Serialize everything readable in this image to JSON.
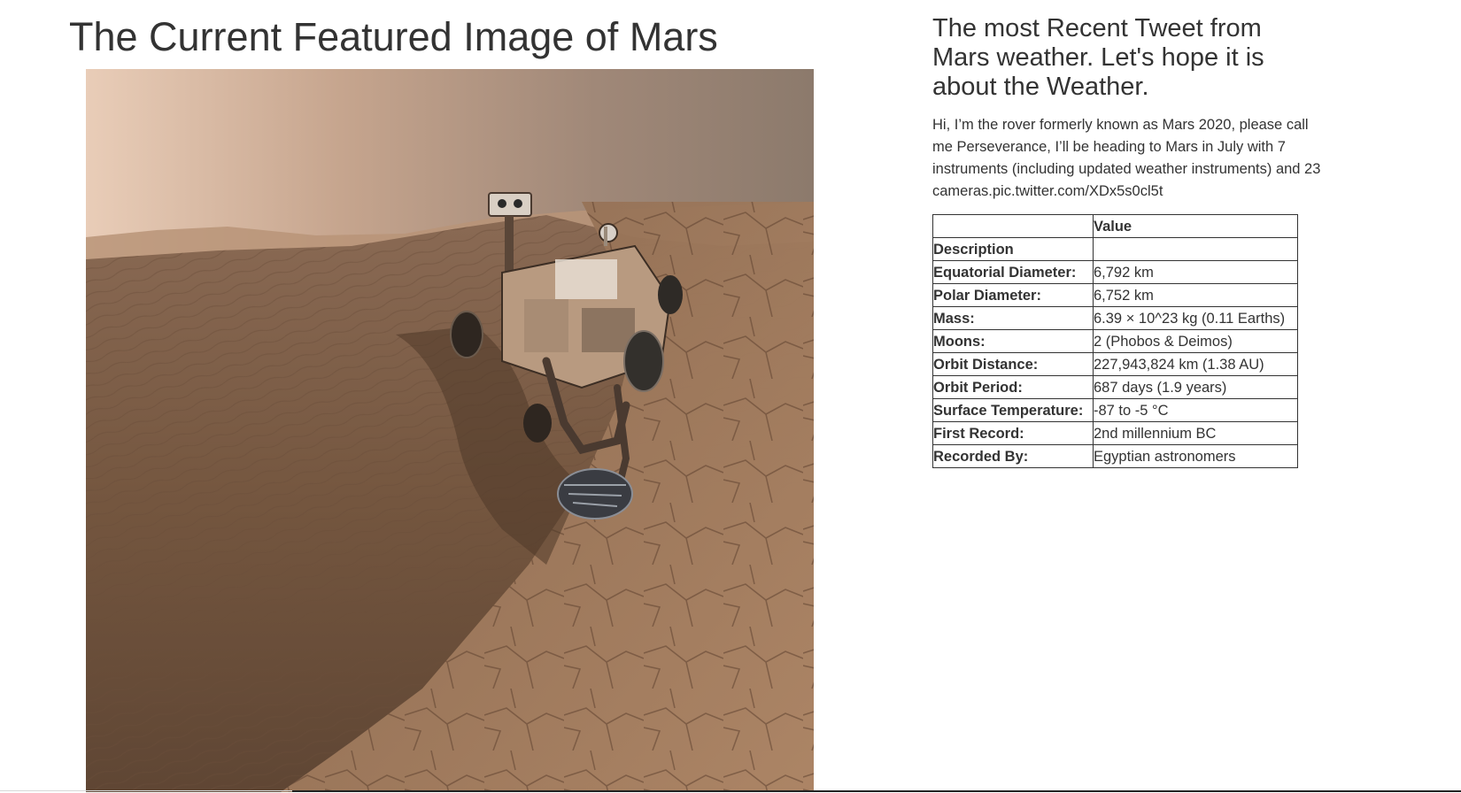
{
  "featured": {
    "title": "The Current Featured Image of Mars"
  },
  "weather": {
    "heading": "The most Recent Tweet from Mars weather. Let's hope it is about the Weather.",
    "tweet": "Hi, I’m the rover formerly known as Mars 2020, please call me Perseverance, I’ll be heading to Mars in July with 7 instruments (including updated weather instruments) and 23 cameras.pic.twitter.com/XDx5s0cl5t"
  },
  "facts": {
    "header_label": "",
    "header_value": "Value",
    "rows": [
      {
        "label": "Description",
        "value": ""
      },
      {
        "label": "Equatorial Diameter:",
        "value": "6,792 km"
      },
      {
        "label": "Polar Diameter:",
        "value": "6,752 km"
      },
      {
        "label": "Mass:",
        "value": "6.39 × 10^23 kg (0.11 Earths)"
      },
      {
        "label": "Moons:",
        "value": "2 (Phobos & Deimos)"
      },
      {
        "label": "Orbit Distance:",
        "value": "227,943,824 km (1.38 AU)"
      },
      {
        "label": "Orbit Period:",
        "value": "687 days (1.9 years)"
      },
      {
        "label": "Surface Temperature:",
        "value": "-87 to -5 °C"
      },
      {
        "label": "First Record:",
        "value": "2nd millennium BC"
      },
      {
        "label": "Recorded By:",
        "value": "Egyptian astronomers"
      }
    ]
  },
  "colors": {
    "text": "#333333",
    "table_border": "#333333",
    "sky_light": "#e9cdb6",
    "sky_dark": "#8a7565",
    "sand": "#7a5a44",
    "rock": "#a07a5c"
  }
}
